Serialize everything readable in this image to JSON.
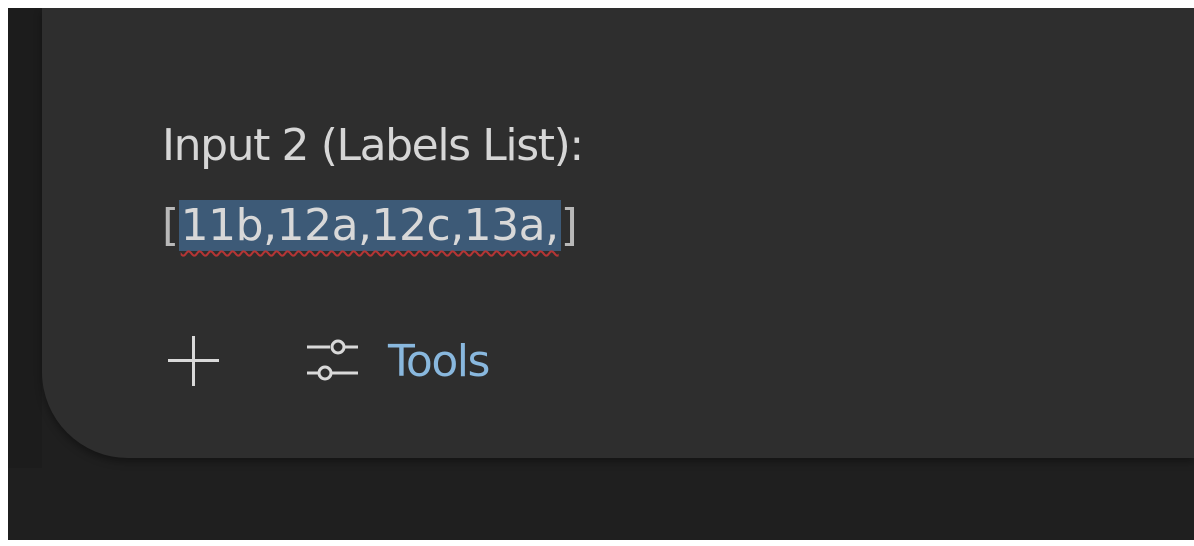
{
  "composer": {
    "prompt_label": "Input 2 (Labels List):",
    "prompt_value": {
      "open_bracket": "[",
      "selected_text": "11b,12a,12c,13a,",
      "close_bracket": "]"
    }
  },
  "toolbar": {
    "add_icon": "plus-icon",
    "tools_icon": "sliders-icon",
    "tools_label": "Tools"
  },
  "colors": {
    "panel": "#2e2e2e",
    "background": "#1f1f1f",
    "selection": "#3d5a77",
    "tools_text": "#89b8de",
    "spellcheck": "#b53535"
  }
}
